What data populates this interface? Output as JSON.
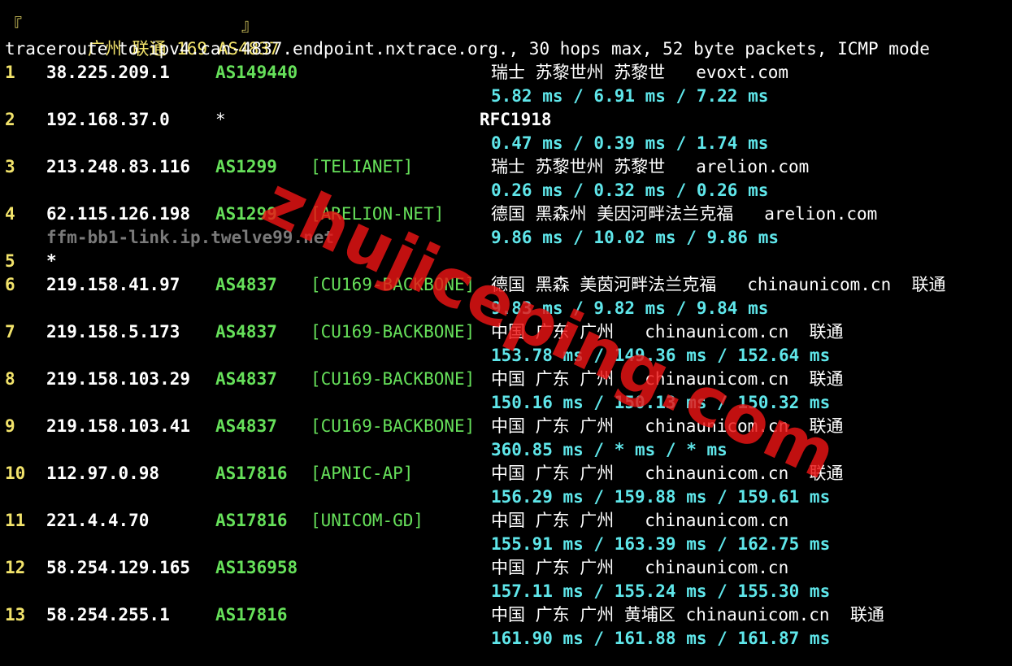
{
  "title": {
    "open": "『",
    "text": "广州 联通 169 AS4837",
    "close": "』"
  },
  "header": "traceroute to ipv4.can-4837.endpoint.nxtrace.org., 30 hops max, 52 byte packets, ICMP mode",
  "hops": [
    {
      "num": "1",
      "ip": "38.225.209.1",
      "as": "AS149440",
      "net": "",
      "geo": "瑞士 苏黎世州 苏黎世   evoxt.com",
      "rdns": "",
      "ms": "5.82 ms / 6.91 ms / 7.22 ms"
    },
    {
      "num": "2",
      "ip": "192.168.37.0",
      "as": "*",
      "net": "",
      "geo": "RFC1918",
      "rdns": "",
      "ms": "0.47 ms / 0.39 ms / 1.74 ms"
    },
    {
      "num": "3",
      "ip": "213.248.83.116",
      "as": "AS1299",
      "net": "[TELIANET]",
      "geo": "瑞士 苏黎世州 苏黎世   arelion.com",
      "rdns": "",
      "ms": "0.26 ms / 0.32 ms / 0.26 ms"
    },
    {
      "num": "4",
      "ip": "62.115.126.198",
      "as": "AS1299",
      "net": "[ARELION-NET]",
      "geo": "德国 黑森州 美因河畔法兰克福   arelion.com",
      "rdns": "ffm-bb1-link.ip.twelve99.net",
      "ms": "9.86 ms / 10.02 ms / 9.86 ms"
    },
    {
      "num": "5",
      "ip": "*",
      "as": "",
      "net": "",
      "geo": "",
      "rdns": "",
      "ms": ""
    },
    {
      "num": "6",
      "ip": "219.158.41.97",
      "as": "AS4837",
      "net": "[CU169-BACKBONE]",
      "geo": "德国 黑森 美茵河畔法兰克福   chinaunicom.cn  联通",
      "rdns": "",
      "ms": "9.83 ms / 9.82 ms / 9.84 ms"
    },
    {
      "num": "7",
      "ip": "219.158.5.173",
      "as": "AS4837",
      "net": "[CU169-BACKBONE]",
      "geo": "中国 广东 广州   chinaunicom.cn  联通",
      "rdns": "",
      "ms": "153.78 ms / 149.36 ms / 152.64 ms"
    },
    {
      "num": "8",
      "ip": "219.158.103.29",
      "as": "AS4837",
      "net": "[CU169-BACKBONE]",
      "geo": "中国 广东 广州   chinaunicom.cn  联通",
      "rdns": "",
      "ms": "150.16 ms / 150.13 ms / 150.32 ms"
    },
    {
      "num": "9",
      "ip": "219.158.103.41",
      "as": "AS4837",
      "net": "[CU169-BACKBONE]",
      "geo": "中国 广东 广州   chinaunicom.cn  联通",
      "rdns": "",
      "ms": "360.85 ms / * ms / * ms"
    },
    {
      "num": "10",
      "ip": "112.97.0.98",
      "as": "AS17816",
      "net": "[APNIC-AP]",
      "geo": "中国 广东 广州   chinaunicom.cn  联通",
      "rdns": "",
      "ms": "156.29 ms / 159.88 ms / 159.61 ms"
    },
    {
      "num": "11",
      "ip": "221.4.4.70",
      "as": "AS17816",
      "net": "[UNICOM-GD]",
      "geo": "中国 广东 广州   chinaunicom.cn",
      "rdns": "",
      "ms": "155.91 ms / 163.39 ms / 162.75 ms"
    },
    {
      "num": "12",
      "ip": "58.254.129.165",
      "as": "AS136958",
      "net": "",
      "geo": "中国 广东 广州   chinaunicom.cn",
      "rdns": "",
      "ms": "157.11 ms / 155.24 ms / 155.30 ms"
    },
    {
      "num": "13",
      "ip": "58.254.255.1",
      "as": "AS17816",
      "net": "",
      "geo": "中国 广东 广州 黄埔区 chinaunicom.cn  联通",
      "rdns": "",
      "ms": "161.90 ms / 161.88 ms / 161.87 ms"
    }
  ],
  "watermark": "zhujiceping.com",
  "colors": {
    "hop_number": "#f2e36b",
    "ip": "#ffffff",
    "asn": "#66e05a",
    "latency": "#5fe6ea",
    "rdns": "#7a7a7a",
    "watermark": "#eb1414"
  }
}
